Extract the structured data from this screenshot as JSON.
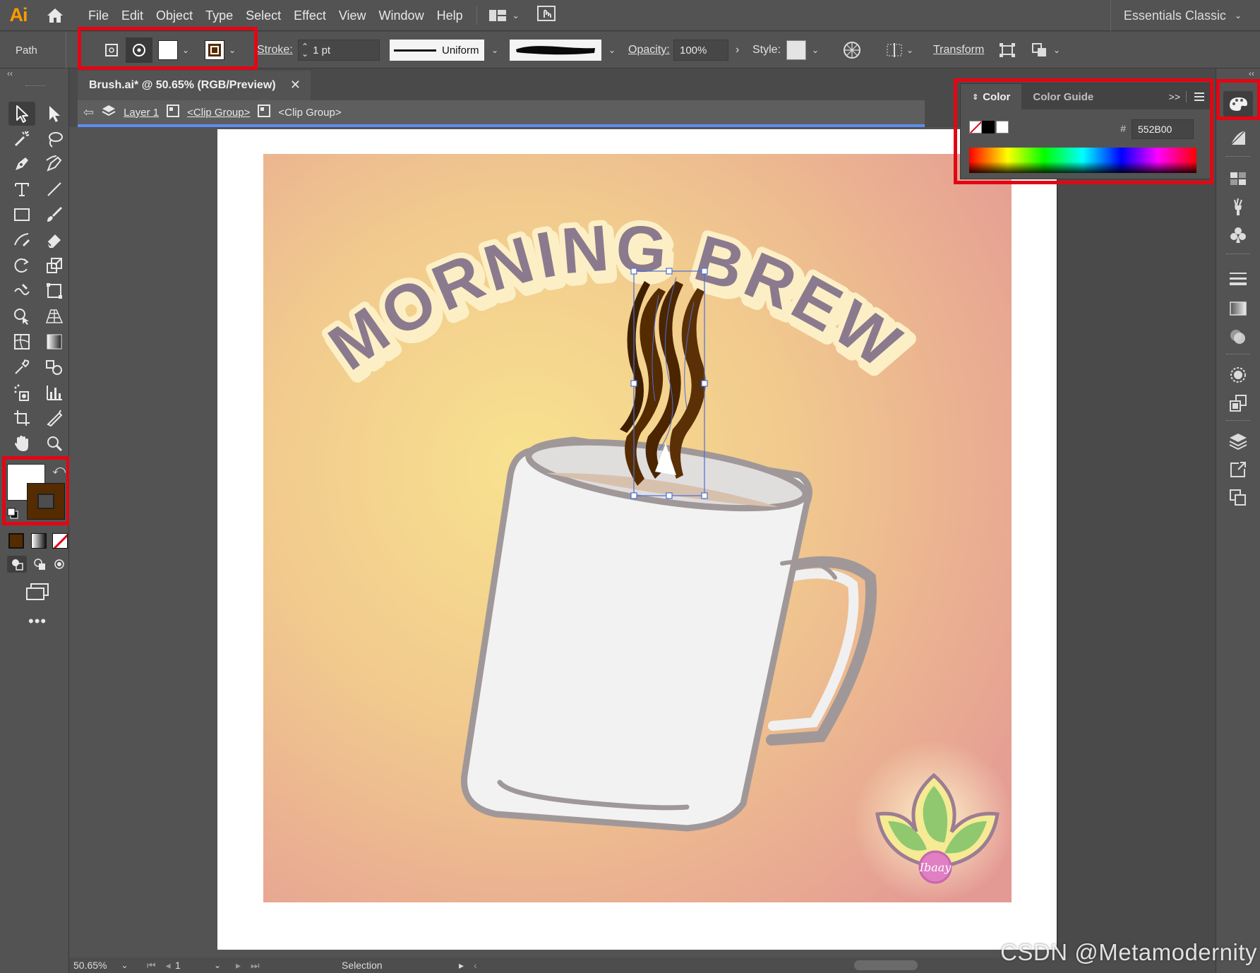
{
  "app": {
    "logo": "Ai"
  },
  "menu": {
    "items": [
      "File",
      "Edit",
      "Object",
      "Type",
      "Select",
      "Effect",
      "View",
      "Window",
      "Help"
    ]
  },
  "workspace": {
    "label": "Essentials Classic"
  },
  "control_bar": {
    "selection_type": "Path",
    "fill_color": "#FFFFFF",
    "stroke_color": "#552B00",
    "stroke_label": "Stroke:",
    "stroke_weight": "1 pt",
    "stroke_profile": "Uniform",
    "opacity_label": "Opacity:",
    "opacity_value": "100%",
    "style_label": "Style:",
    "transform_label": "Transform"
  },
  "document": {
    "tab_title": "Brush.ai* @ 50.65% (RGB/Preview)",
    "close_glyph": "✕"
  },
  "breadcrumb": {
    "layer": "Layer 1",
    "group1": "<Clip Group>",
    "group2": "<Clip Group>"
  },
  "color_panel": {
    "tabs": [
      "Color",
      "Color Guide"
    ],
    "active_tab": "Color",
    "hex_prefix": "#",
    "hex_value": "552B00",
    "expand_glyph": ">>"
  },
  "artwork": {
    "title": "MORNING BREW",
    "badge_text": "Ibaay"
  },
  "status_bar": {
    "zoom": "50.65%",
    "artboard_number": "1",
    "current_tool": "Selection"
  },
  "watermark": {
    "text": "CSDN @Metamodernity"
  },
  "colors": {
    "accent_highlight": "#e30613",
    "selection_blue": "#4a6fd8",
    "brush_brown": "#552B00",
    "title_purple": "#8b7a8e",
    "title_outline": "#fcefc5"
  },
  "icons": [
    "home-icon",
    "selection-tool-icon",
    "direct-selection-tool-icon",
    "magic-wand-icon",
    "lasso-icon",
    "pen-tool-icon",
    "curvature-tool-icon",
    "type-tool-icon",
    "line-tool-icon",
    "rectangle-tool-icon",
    "paintbrush-icon",
    "shaper-tool-icon",
    "eraser-icon",
    "rotate-icon",
    "scale-icon",
    "warp-icon",
    "free-transform-icon",
    "shape-builder-icon",
    "perspective-grid-icon",
    "mesh-icon",
    "gradient-tool-icon",
    "eyedropper-icon",
    "blend-icon",
    "symbol-sprayer-icon",
    "graph-icon",
    "artboard-tool-icon",
    "slice-icon",
    "hand-icon",
    "zoom-icon",
    "swap-colors-icon",
    "default-colors-icon",
    "color-mode-icon",
    "gradient-mode-icon",
    "none-mode-icon",
    "draw-normal-icon",
    "draw-behind-icon",
    "draw-inside-icon",
    "screen-mode-icon",
    "more-tools-icon",
    "color-panel-icon",
    "color-guide-icon",
    "swatches-icon",
    "brushes-icon",
    "symbols-icon",
    "stroke-panel-icon",
    "gradient-panel-icon",
    "transparency-icon",
    "appearance-icon",
    "graphic-styles-icon",
    "layers-icon",
    "asset-export-icon",
    "artboards-icon"
  ]
}
